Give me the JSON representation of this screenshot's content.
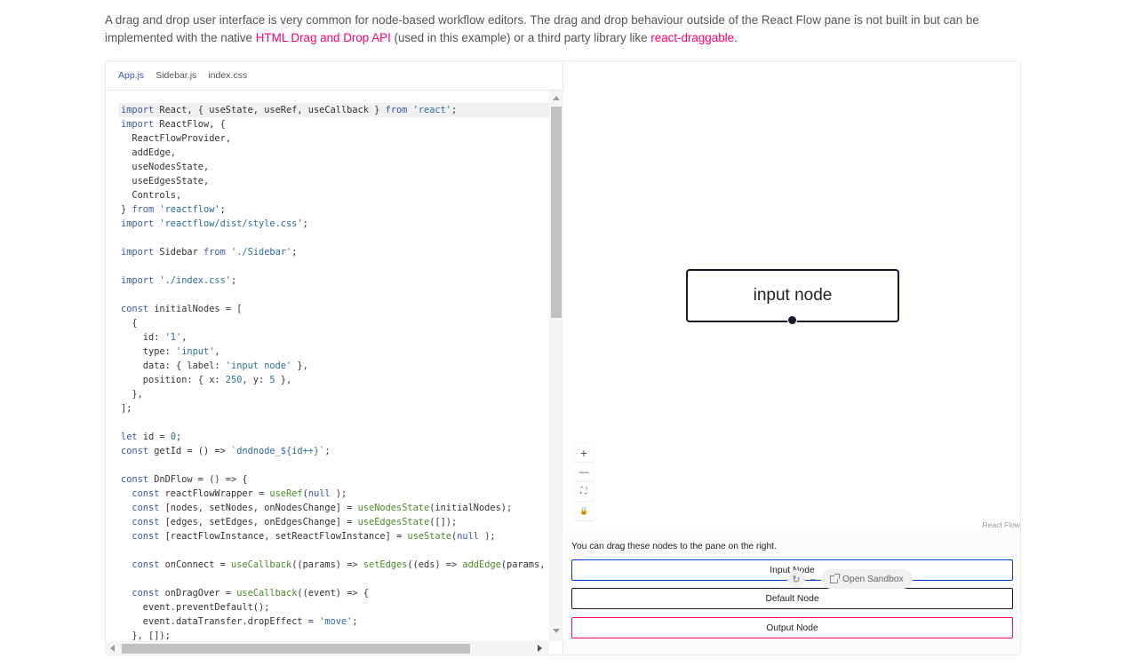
{
  "intro": {
    "text_1": "A drag and drop user interface is very common for node-based workflow editors. The drag and drop behaviour outside of the React Flow pane is not built in but can be implemented with the native ",
    "link_1": "HTML Drag and Drop API",
    "text_2": " (used in this example) or a third party library like ",
    "link_2": "react-draggable",
    "text_3": "."
  },
  "editor": {
    "tabs": [
      {
        "label": "App.js",
        "active": true
      },
      {
        "label": "Sidebar.js",
        "active": false
      },
      {
        "label": "index.css",
        "active": false
      }
    ]
  },
  "code_lines": [
    [
      [
        "kw",
        "import"
      ],
      [
        "",
        "React, { useState, useRef, useCallback } "
      ],
      [
        "kw",
        "from"
      ],
      [
        "str",
        " 'react'"
      ],
      [
        "",
        ";"
      ]
    ],
    [
      [
        "kw",
        "import"
      ],
      [
        "",
        "ReactFlow, {"
      ]
    ],
    [
      [
        "",
        "  ReactFlowProvider,"
      ]
    ],
    [
      [
        "",
        "  addEdge,"
      ]
    ],
    [
      [
        "",
        "  useNodesState,"
      ]
    ],
    [
      [
        "",
        "  useEdgesState,"
      ]
    ],
    [
      [
        "",
        "  Controls,"
      ]
    ],
    [
      [
        "",
        "} "
      ],
      [
        "kw",
        "from"
      ],
      [
        "str",
        " 'reactflow'"
      ],
      [
        "",
        ";"
      ]
    ],
    [
      [
        "kw",
        "import"
      ],
      [
        "str",
        " 'reactflow/dist/style.css'"
      ],
      [
        "",
        ";"
      ]
    ],
    [
      [
        "",
        ""
      ]
    ],
    [
      [
        "kw",
        "import"
      ],
      [
        "",
        "Sidebar "
      ],
      [
        "kw",
        "from"
      ],
      [
        "str",
        " './Sidebar'"
      ],
      [
        "",
        ";"
      ]
    ],
    [
      [
        "",
        ""
      ]
    ],
    [
      [
        "kw",
        "import"
      ],
      [
        "str",
        " './index.css'"
      ],
      [
        "",
        ";"
      ]
    ],
    [
      [
        "",
        ""
      ]
    ],
    [
      [
        "kw",
        "const"
      ],
      [
        "",
        " initialNodes = ["
      ]
    ],
    [
      [
        "",
        "  {"
      ]
    ],
    [
      [
        "",
        "    id: "
      ],
      [
        "str",
        "'1'"
      ],
      [
        "",
        ","
      ]
    ],
    [
      [
        "",
        "    type: "
      ],
      [
        "str",
        "'input'"
      ],
      [
        "",
        ","
      ]
    ],
    [
      [
        "",
        "    data: { label: "
      ],
      [
        "str",
        "'input node'"
      ],
      [
        "",
        " },"
      ]
    ],
    [
      [
        "",
        "    position: { x: "
      ],
      [
        "num",
        "250"
      ],
      [
        "",
        ", y: "
      ],
      [
        "num",
        "5"
      ],
      [
        "",
        " },"
      ]
    ],
    [
      [
        "",
        "  },"
      ]
    ],
    [
      [
        "",
        "];"
      ]
    ],
    [
      [
        "",
        ""
      ]
    ],
    [
      [
        "kw",
        "let"
      ],
      [
        "",
        " id = "
      ],
      [
        "num",
        "0"
      ],
      [
        "",
        ";"
      ]
    ],
    [
      [
        "kw",
        "const"
      ],
      [
        "",
        " getId = () => "
      ],
      [
        "str",
        "`dndnode_${id++}`"
      ],
      [
        "",
        ";"
      ]
    ],
    [
      [
        "",
        ""
      ]
    ],
    [
      [
        "kw",
        "const"
      ],
      [
        "",
        " DnDFlow = () => {"
      ]
    ],
    [
      [
        "kw",
        "  const"
      ],
      [
        "",
        " reactFlowWrapper = "
      ],
      [
        "fn",
        "useRef"
      ],
      [
        "",
        "("
      ],
      [
        "kw",
        "null"
      ],
      [
        "",
        ");"
      ]
    ],
    [
      [
        "kw",
        "  const"
      ],
      [
        "",
        " [nodes, setNodes, onNodesChange] = "
      ],
      [
        "fn",
        "useNodesState"
      ],
      [
        "",
        "(initialNodes);"
      ]
    ],
    [
      [
        "kw",
        "  const"
      ],
      [
        "",
        " [edges, setEdges, onEdgesChange] = "
      ],
      [
        "fn",
        "useEdgesState"
      ],
      [
        "",
        "([]);"
      ]
    ],
    [
      [
        "kw",
        "  const"
      ],
      [
        "",
        " [reactFlowInstance, setReactFlowInstance] = "
      ],
      [
        "fn",
        "useState"
      ],
      [
        "",
        "("
      ],
      [
        "kw",
        "null"
      ],
      [
        "",
        ");"
      ]
    ],
    [
      [
        "",
        ""
      ]
    ],
    [
      [
        "kw",
        "  const"
      ],
      [
        "",
        " onConnect = "
      ],
      [
        "fn",
        "useCallback"
      ],
      [
        "",
        "((params) => "
      ],
      [
        "fn",
        "setEdges"
      ],
      [
        "",
        "((eds) => "
      ],
      [
        "fn",
        "addEdge"
      ],
      [
        "",
        "(params,"
      ]
    ],
    [
      [
        "",
        ""
      ]
    ],
    [
      [
        "kw",
        "  const"
      ],
      [
        "",
        " onDragOver = "
      ],
      [
        "fn",
        "useCallback"
      ],
      [
        "",
        "((event) => {"
      ]
    ],
    [
      [
        "",
        "    event.preventDefault();"
      ]
    ],
    [
      [
        "",
        "    event.dataTransfer.dropEffect = "
      ],
      [
        "str",
        "'move'"
      ],
      [
        "",
        ";"
      ]
    ],
    [
      [
        "",
        "  }, []);"
      ]
    ]
  ],
  "flow": {
    "node_label": "input node",
    "controls": {
      "zoom_in": "+",
      "zoom_out": "—",
      "fit_view": "⛶",
      "lock": "🔒"
    },
    "attribution": "React Flow"
  },
  "sidebar": {
    "description": "You can drag these nodes to the pane on the right.",
    "input_node": "Input Node",
    "default_node": "Default Node",
    "output_node": "Output Node"
  },
  "sandbox": {
    "refresh_icon": "↻",
    "open_label": "Open Sandbox"
  }
}
